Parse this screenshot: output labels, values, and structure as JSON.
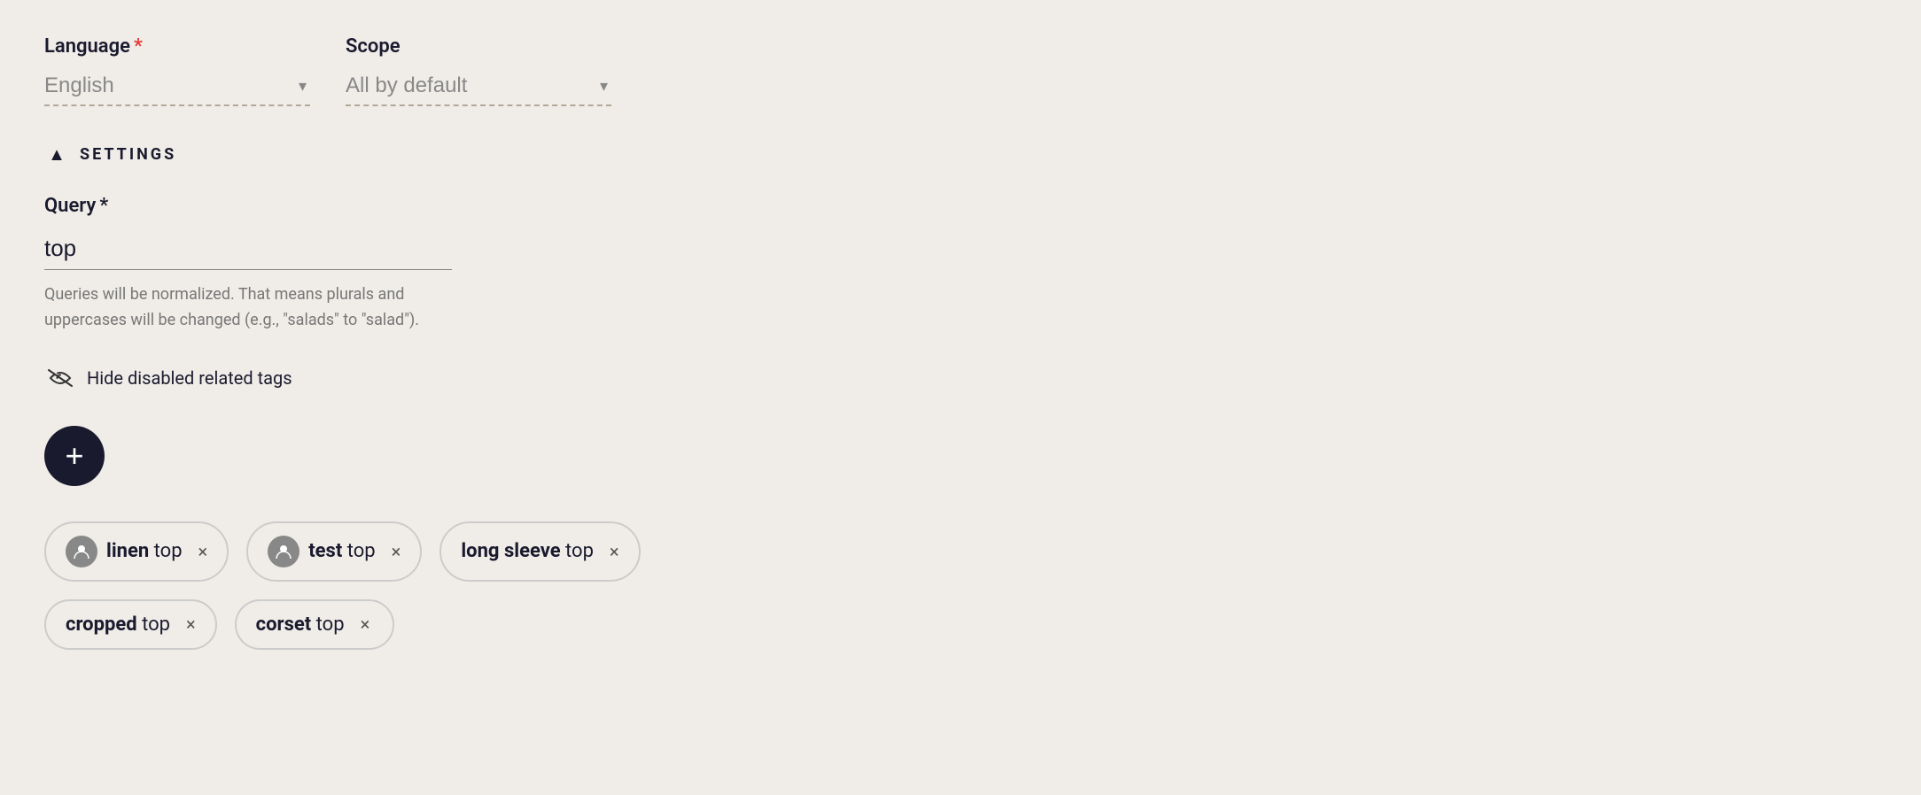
{
  "language_field": {
    "label": "Language",
    "required": true,
    "value": "English",
    "placeholder": "English"
  },
  "scope_field": {
    "label": "Scope",
    "required": false,
    "value": "All by default",
    "placeholder": "All by default"
  },
  "settings_section": {
    "title": "SETTINGS",
    "chevron": "▲"
  },
  "query_field": {
    "label": "Query",
    "required": true,
    "value": "top",
    "hint": "Queries will be normalized. That means plurals and uppercases will be changed (e.g., \"salads\" to \"salad\")."
  },
  "hide_tags": {
    "label": "Hide disabled related tags"
  },
  "add_button": {
    "label": "+"
  },
  "tags": [
    {
      "id": "tag-linen",
      "bold_text": "linen",
      "normal_text": " top",
      "has_avatar": true,
      "close": "×"
    },
    {
      "id": "tag-test",
      "bold_text": "test",
      "normal_text": " top",
      "has_avatar": true,
      "close": "×"
    },
    {
      "id": "tag-long-sleeve",
      "bold_text": "long sleeve",
      "normal_text": " top",
      "has_avatar": false,
      "close": "×"
    },
    {
      "id": "tag-cropped",
      "bold_text": "cropped",
      "normal_text": " top",
      "has_avatar": false,
      "close": "×"
    },
    {
      "id": "tag-corset",
      "bold_text": "corset",
      "normal_text": " top",
      "has_avatar": false,
      "close": "×"
    }
  ]
}
